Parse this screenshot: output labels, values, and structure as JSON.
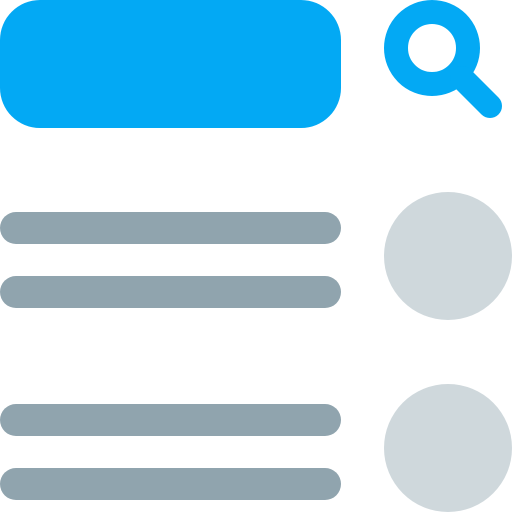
{
  "colors": {
    "accent": "#03A9F4",
    "line": "#90A4AE",
    "dot": "#CFD8DC",
    "background": "#FFFFFF"
  },
  "search": {
    "icon": "search-icon"
  },
  "list": {
    "items": [
      {
        "icon": "circle-placeholder",
        "lines": 2
      },
      {
        "icon": "circle-placeholder",
        "lines": 2
      }
    ]
  }
}
